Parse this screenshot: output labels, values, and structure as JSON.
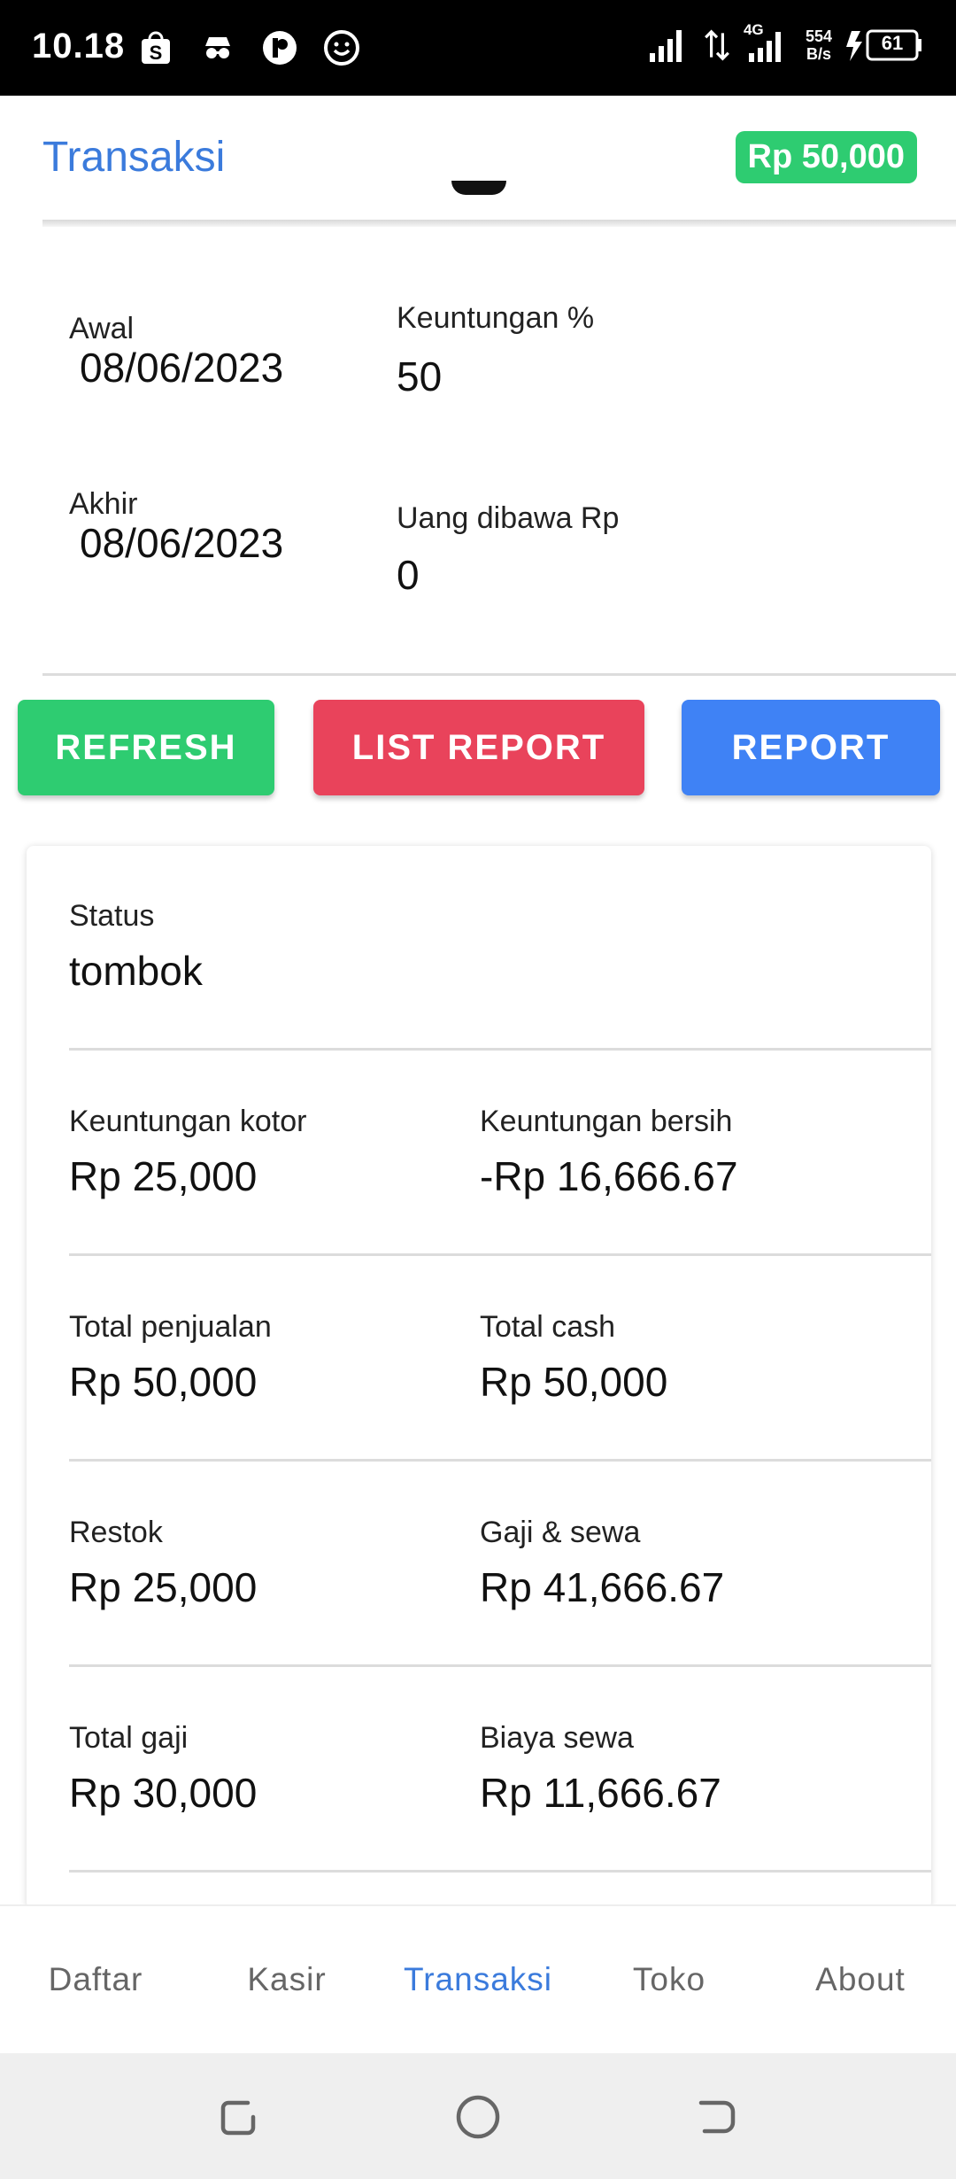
{
  "status_bar": {
    "time": "10.18",
    "network_type": "4G",
    "speed_value": "554",
    "speed_unit": "B/s",
    "battery": "61"
  },
  "header": {
    "title": "Transaksi",
    "balance": "Rp 50,000"
  },
  "filters": {
    "awal_label": "Awal",
    "awal_value": "08/06/2023",
    "akhir_label": "Akhir",
    "akhir_value": "08/06/2023",
    "keuntungan_label": "Keuntungan %",
    "keuntungan_value": "50",
    "uang_label": "Uang dibawa Rp",
    "uang_value": "0"
  },
  "actions": {
    "refresh": "REFRESH",
    "list_report": "LIST REPORT",
    "report": "REPORT"
  },
  "report": {
    "status_label": "Status",
    "status_value": "tombok",
    "rows": [
      {
        "left_label": "Keuntungan kotor",
        "left_value": "Rp 25,000",
        "right_label": "Keuntungan bersih",
        "right_value": "-Rp 16,666.67"
      },
      {
        "left_label": "Total penjualan",
        "left_value": "Rp 50,000",
        "right_label": "Total cash",
        "right_value": "Rp 50,000"
      },
      {
        "left_label": "Restok",
        "left_value": "Rp 25,000",
        "right_label": "Gaji & sewa",
        "right_value": "Rp 41,666.67"
      },
      {
        "left_label": "Total gaji",
        "left_value": "Rp 30,000",
        "right_label": "Biaya sewa",
        "right_value": "Rp 11,666.67"
      }
    ]
  },
  "bottom_nav": {
    "items": [
      {
        "label": "Daftar"
      },
      {
        "label": "Kasir"
      },
      {
        "label": "Transaksi"
      },
      {
        "label": "Toko"
      },
      {
        "label": "About"
      }
    ],
    "active": "Transaksi"
  },
  "colors": {
    "accent_blue": "#3b7bdc",
    "green": "#2ecc71",
    "red": "#e9435b",
    "blue_button": "#3f82f5"
  },
  "icons": {
    "status_left": [
      "shopee-icon",
      "incognito-icon",
      "app-icon",
      "smiley-icon"
    ],
    "status_right": [
      "signal-icon",
      "data-arrows-icon",
      "signal-4g-icon",
      "battery-charging-icon"
    ],
    "system_nav": [
      "recents-icon",
      "home-icon",
      "back-icon"
    ]
  }
}
